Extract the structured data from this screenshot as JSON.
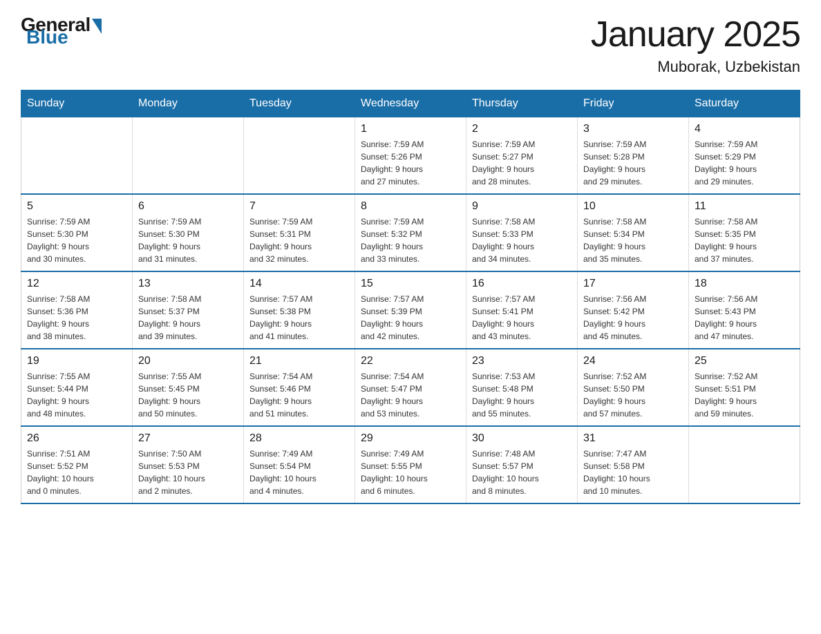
{
  "logo": {
    "general": "General",
    "blue": "Blue"
  },
  "header": {
    "title": "January 2025",
    "subtitle": "Muborak, Uzbekistan"
  },
  "days_of_week": [
    "Sunday",
    "Monday",
    "Tuesday",
    "Wednesday",
    "Thursday",
    "Friday",
    "Saturday"
  ],
  "weeks": [
    [
      {
        "day": "",
        "info": ""
      },
      {
        "day": "",
        "info": ""
      },
      {
        "day": "",
        "info": ""
      },
      {
        "day": "1",
        "info": "Sunrise: 7:59 AM\nSunset: 5:26 PM\nDaylight: 9 hours\nand 27 minutes."
      },
      {
        "day": "2",
        "info": "Sunrise: 7:59 AM\nSunset: 5:27 PM\nDaylight: 9 hours\nand 28 minutes."
      },
      {
        "day": "3",
        "info": "Sunrise: 7:59 AM\nSunset: 5:28 PM\nDaylight: 9 hours\nand 29 minutes."
      },
      {
        "day": "4",
        "info": "Sunrise: 7:59 AM\nSunset: 5:29 PM\nDaylight: 9 hours\nand 29 minutes."
      }
    ],
    [
      {
        "day": "5",
        "info": "Sunrise: 7:59 AM\nSunset: 5:30 PM\nDaylight: 9 hours\nand 30 minutes."
      },
      {
        "day": "6",
        "info": "Sunrise: 7:59 AM\nSunset: 5:30 PM\nDaylight: 9 hours\nand 31 minutes."
      },
      {
        "day": "7",
        "info": "Sunrise: 7:59 AM\nSunset: 5:31 PM\nDaylight: 9 hours\nand 32 minutes."
      },
      {
        "day": "8",
        "info": "Sunrise: 7:59 AM\nSunset: 5:32 PM\nDaylight: 9 hours\nand 33 minutes."
      },
      {
        "day": "9",
        "info": "Sunrise: 7:58 AM\nSunset: 5:33 PM\nDaylight: 9 hours\nand 34 minutes."
      },
      {
        "day": "10",
        "info": "Sunrise: 7:58 AM\nSunset: 5:34 PM\nDaylight: 9 hours\nand 35 minutes."
      },
      {
        "day": "11",
        "info": "Sunrise: 7:58 AM\nSunset: 5:35 PM\nDaylight: 9 hours\nand 37 minutes."
      }
    ],
    [
      {
        "day": "12",
        "info": "Sunrise: 7:58 AM\nSunset: 5:36 PM\nDaylight: 9 hours\nand 38 minutes."
      },
      {
        "day": "13",
        "info": "Sunrise: 7:58 AM\nSunset: 5:37 PM\nDaylight: 9 hours\nand 39 minutes."
      },
      {
        "day": "14",
        "info": "Sunrise: 7:57 AM\nSunset: 5:38 PM\nDaylight: 9 hours\nand 41 minutes."
      },
      {
        "day": "15",
        "info": "Sunrise: 7:57 AM\nSunset: 5:39 PM\nDaylight: 9 hours\nand 42 minutes."
      },
      {
        "day": "16",
        "info": "Sunrise: 7:57 AM\nSunset: 5:41 PM\nDaylight: 9 hours\nand 43 minutes."
      },
      {
        "day": "17",
        "info": "Sunrise: 7:56 AM\nSunset: 5:42 PM\nDaylight: 9 hours\nand 45 minutes."
      },
      {
        "day": "18",
        "info": "Sunrise: 7:56 AM\nSunset: 5:43 PM\nDaylight: 9 hours\nand 47 minutes."
      }
    ],
    [
      {
        "day": "19",
        "info": "Sunrise: 7:55 AM\nSunset: 5:44 PM\nDaylight: 9 hours\nand 48 minutes."
      },
      {
        "day": "20",
        "info": "Sunrise: 7:55 AM\nSunset: 5:45 PM\nDaylight: 9 hours\nand 50 minutes."
      },
      {
        "day": "21",
        "info": "Sunrise: 7:54 AM\nSunset: 5:46 PM\nDaylight: 9 hours\nand 51 minutes."
      },
      {
        "day": "22",
        "info": "Sunrise: 7:54 AM\nSunset: 5:47 PM\nDaylight: 9 hours\nand 53 minutes."
      },
      {
        "day": "23",
        "info": "Sunrise: 7:53 AM\nSunset: 5:48 PM\nDaylight: 9 hours\nand 55 minutes."
      },
      {
        "day": "24",
        "info": "Sunrise: 7:52 AM\nSunset: 5:50 PM\nDaylight: 9 hours\nand 57 minutes."
      },
      {
        "day": "25",
        "info": "Sunrise: 7:52 AM\nSunset: 5:51 PM\nDaylight: 9 hours\nand 59 minutes."
      }
    ],
    [
      {
        "day": "26",
        "info": "Sunrise: 7:51 AM\nSunset: 5:52 PM\nDaylight: 10 hours\nand 0 minutes."
      },
      {
        "day": "27",
        "info": "Sunrise: 7:50 AM\nSunset: 5:53 PM\nDaylight: 10 hours\nand 2 minutes."
      },
      {
        "day": "28",
        "info": "Sunrise: 7:49 AM\nSunset: 5:54 PM\nDaylight: 10 hours\nand 4 minutes."
      },
      {
        "day": "29",
        "info": "Sunrise: 7:49 AM\nSunset: 5:55 PM\nDaylight: 10 hours\nand 6 minutes."
      },
      {
        "day": "30",
        "info": "Sunrise: 7:48 AM\nSunset: 5:57 PM\nDaylight: 10 hours\nand 8 minutes."
      },
      {
        "day": "31",
        "info": "Sunrise: 7:47 AM\nSunset: 5:58 PM\nDaylight: 10 hours\nand 10 minutes."
      },
      {
        "day": "",
        "info": ""
      }
    ]
  ]
}
